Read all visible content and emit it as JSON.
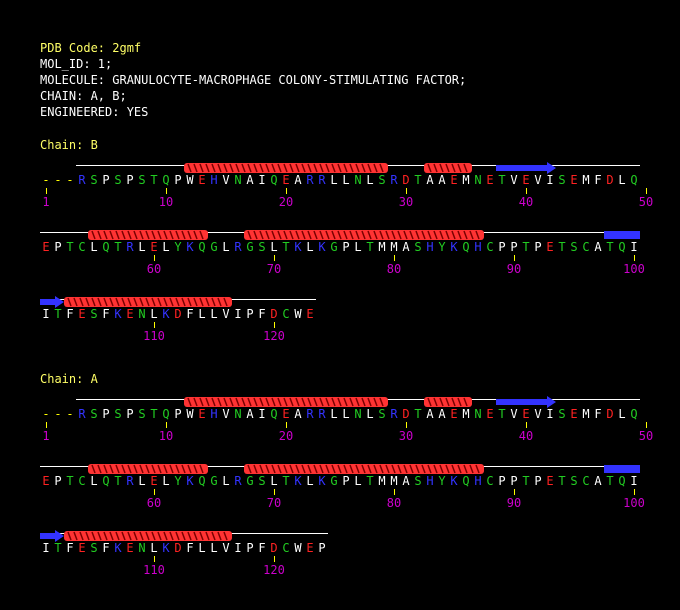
{
  "header": {
    "pdb_code": "PDB Code: 2gmf",
    "mol_id": "MOL_ID: 1;",
    "molecule": "MOLECULE: GRANULOCYTE-MACROPHAGE COLONY-STIMULATING FACTOR;",
    "chain": "CHAIN: A, B;",
    "engineered": "ENGINEERED: YES"
  },
  "colors": {
    "header_label": "#ffff66",
    "text": "#ffffff",
    "helix": "#ff3333",
    "strand": "#3333ff",
    "numbers": "#cc00cc",
    "ticks": "#ffff00",
    "acidic": "#ff2222",
    "basic": "#3333ff",
    "polar": "#22cc22",
    "hydrophobic": "#ffffff"
  },
  "chains": [
    {
      "title": "Chain: B",
      "rows": [
        {
          "residues": "---RSPSPSTQPWEHVNAIQEARRLLNLSRDTAAEMNETVEVISEMFDLQ",
          "numbers": [
            "1",
            "10",
            "20",
            "30",
            "40",
            "50"
          ],
          "helices": [
            [
              12,
              28
            ],
            [
              32,
              35
            ]
          ],
          "strands": [
            [
              38,
              42
            ]
          ]
        },
        {
          "residues": "EPTCLQTRLELYKQGLRGSLTKLKGPLTMMASHYKQHCPPTPETSCATQI",
          "numbers": [
            "60",
            "70",
            "80",
            "90",
            "100"
          ],
          "helices": [
            [
              4,
              13
            ],
            [
              17,
              36
            ]
          ],
          "strands": [
            [
              47,
              49
            ]
          ]
        },
        {
          "residues": "ITFESFKENLKDFLLVIPFDCWE",
          "numbers": [
            "110",
            "120"
          ],
          "helices": [
            [
              2,
              15
            ]
          ],
          "strands": [
            [
              0,
              1
            ]
          ]
        }
      ]
    },
    {
      "title": "Chain: A",
      "rows": [
        {
          "residues": "---RSPSPSTQPWEHVNAIQEARRLLNLSRDTAAEMNETVEVISEMFDLQ",
          "numbers": [
            "1",
            "10",
            "20",
            "30",
            "40",
            "50"
          ],
          "helices": [
            [
              12,
              28
            ],
            [
              32,
              35
            ]
          ],
          "strands": [
            [
              38,
              42
            ]
          ]
        },
        {
          "residues": "EPTCLQTRLELYKQGLRGSLTKLKGPLTMMASHYKQHCPPTPETSCATQI",
          "numbers": [
            "60",
            "70",
            "80",
            "90",
            "100"
          ],
          "helices": [
            [
              4,
              13
            ],
            [
              17,
              36
            ]
          ],
          "strands": [
            [
              47,
              49
            ]
          ]
        },
        {
          "residues": "ITFESFKENLKDFLLVIPFDCWEP",
          "numbers": [
            "110",
            "120"
          ],
          "helices": [
            [
              2,
              15
            ]
          ],
          "strands": [
            [
              0,
              1
            ]
          ]
        }
      ]
    }
  ]
}
